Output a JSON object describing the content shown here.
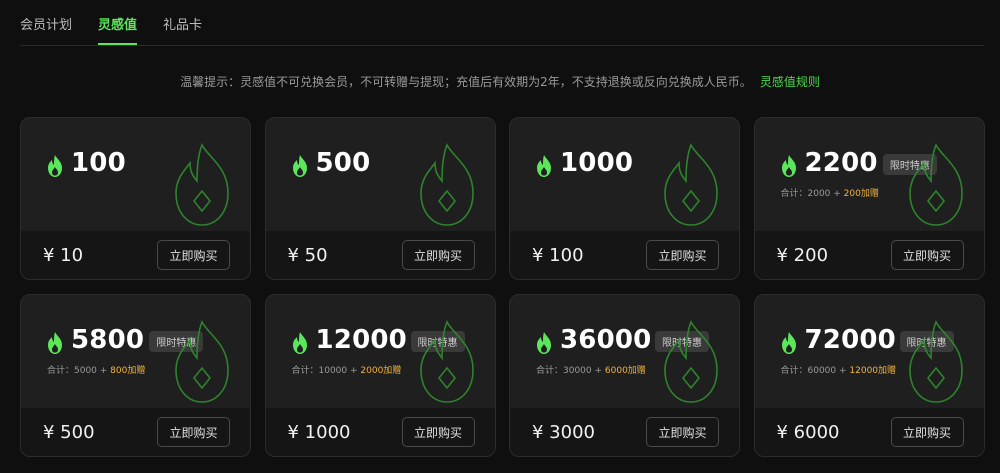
{
  "tabs": [
    {
      "label": "会员计划",
      "active": false
    },
    {
      "label": "灵感值",
      "active": true
    },
    {
      "label": "礼品卡",
      "active": false
    }
  ],
  "notice": {
    "text": "温馨提示：灵感值不可兑换会员，不可转赠与提现；充值后有效期为2年，不支持退换或反向兑换成人民币。",
    "link": "灵感值规则"
  },
  "accent_color": "#5ce65c",
  "bonus_color": "#f0b340",
  "buy_label": "立即购买",
  "packages": [
    {
      "points": "100",
      "price": "¥ 10"
    },
    {
      "points": "500",
      "price": "¥ 50"
    },
    {
      "points": "1000",
      "price": "¥ 100"
    },
    {
      "points": "2200",
      "price": "¥ 200",
      "badge": "限时特惠",
      "detail": "合计：2000 + ",
      "bonus": "200加赠"
    },
    {
      "points": "5800",
      "price": "¥ 500",
      "badge": "限时特惠",
      "detail": "合计：5000 + ",
      "bonus": "800加赠"
    },
    {
      "points": "12000",
      "price": "¥ 1000",
      "badge": "限时特惠",
      "detail": "合计：10000 + ",
      "bonus": "2000加赠"
    },
    {
      "points": "36000",
      "price": "¥ 3000",
      "badge": "限时特惠",
      "detail": "合计：30000 + ",
      "bonus": "6000加赠"
    },
    {
      "points": "72000",
      "price": "¥ 6000",
      "badge": "限时特惠",
      "detail": "合计：60000 + ",
      "bonus": "12000加赠"
    }
  ]
}
